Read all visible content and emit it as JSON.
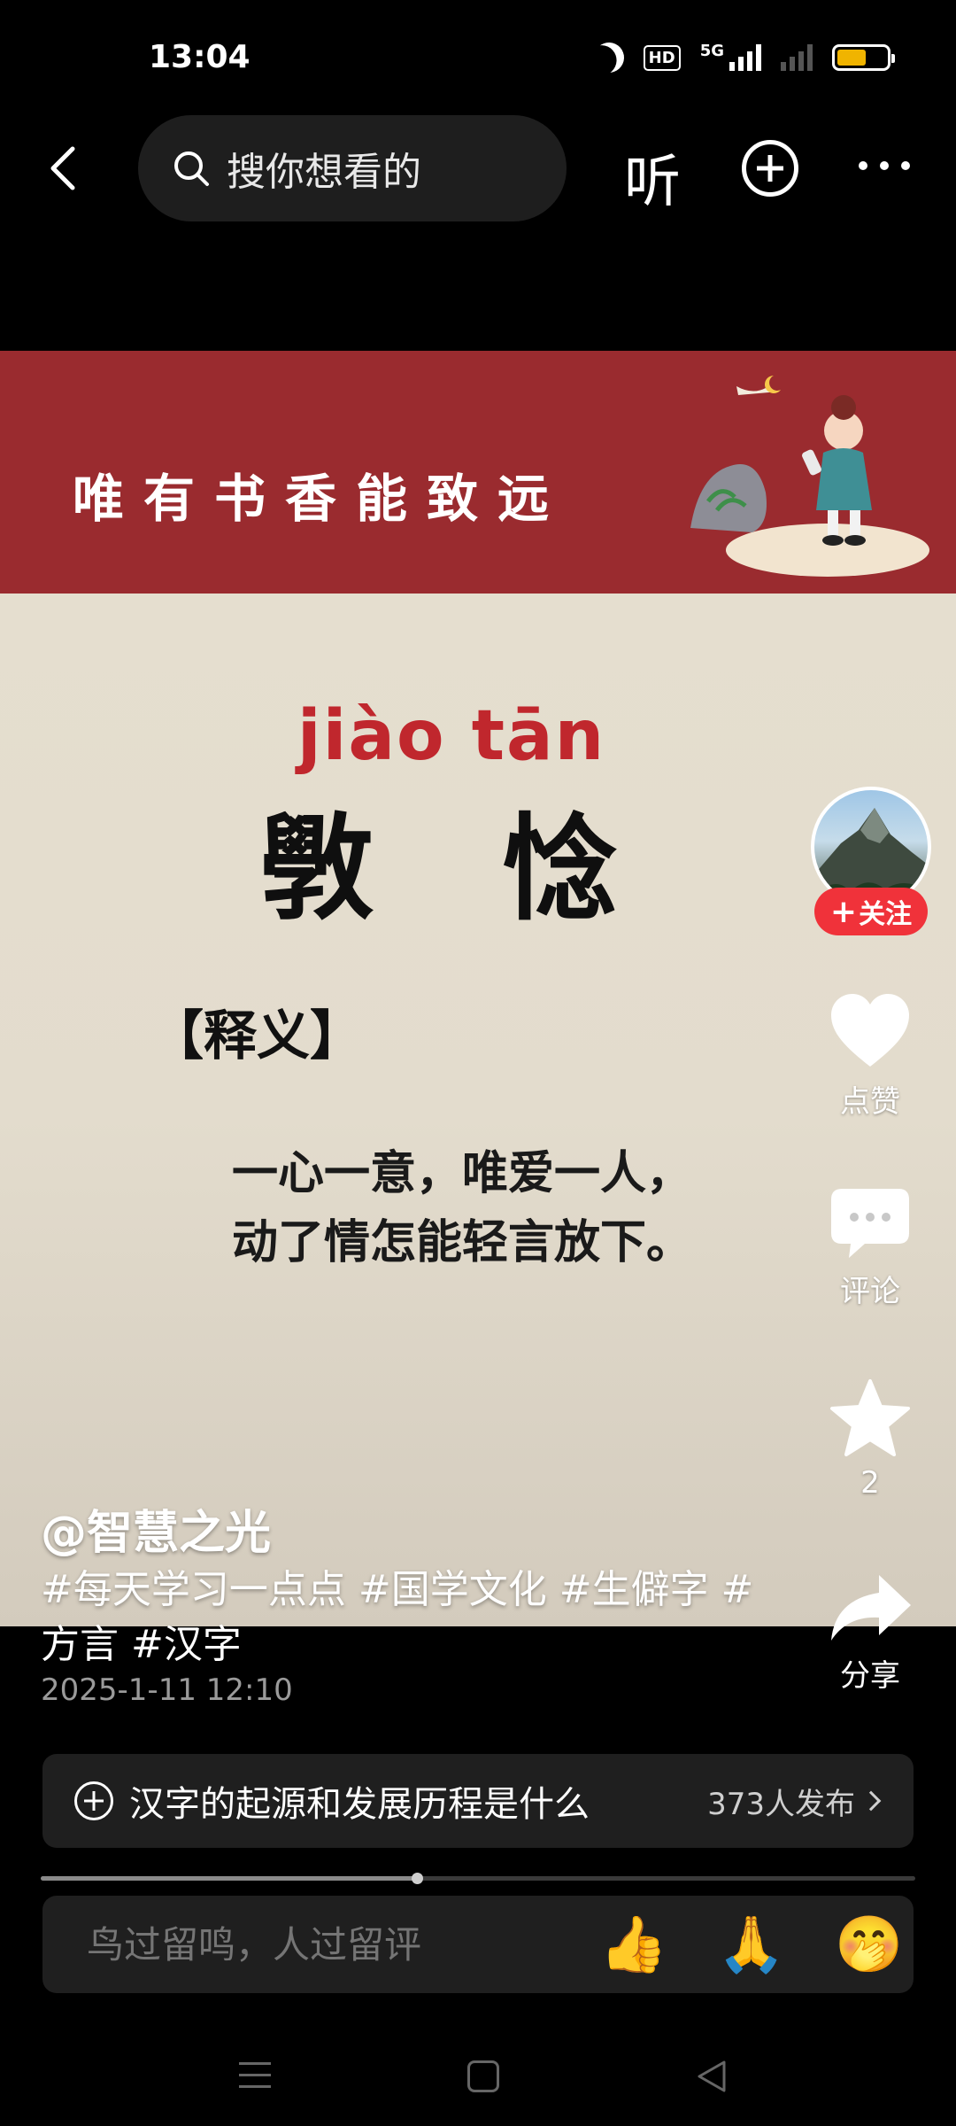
{
  "status_bar": {
    "time": "13:04",
    "hd_badge": "HD",
    "network": "5G",
    "battery_level": 0.6,
    "battery_color": "#f0b400"
  },
  "top_nav": {
    "search_placeholder": "搜你想看的",
    "listen_label": "听"
  },
  "video": {
    "banner_text": "唯有书香能致远",
    "pinyin": "jiào tān",
    "characters": "斆 惗",
    "section_label": "【释义】",
    "definition_lines": [
      "一心一意，唯爱一人，",
      "动了情怎能轻言放下。"
    ]
  },
  "side_actions": {
    "follow_label": "关注",
    "like_label": "点赞",
    "comment_label": "评论",
    "favorite_count": "2",
    "share_label": "分享"
  },
  "caption": {
    "author": "@智慧之光",
    "tags_line1": "#每天学习一点点 #国学文化 #生僻字 #",
    "tags_line2": "方言 #汉字",
    "date": "2025-1-11 12:10"
  },
  "topic": {
    "title": "汉字的起源和发展历程是什么",
    "count": "373人发布"
  },
  "playback": {
    "progress": 0.43
  },
  "comment": {
    "placeholder": "鸟过留鸣，人过留评",
    "emojis": [
      "👍",
      "🙏",
      "🤭"
    ]
  },
  "colors": {
    "banner_red": "#9a2b2f",
    "pinyin_red": "#c0272d",
    "follow_red": "#f0323a"
  }
}
